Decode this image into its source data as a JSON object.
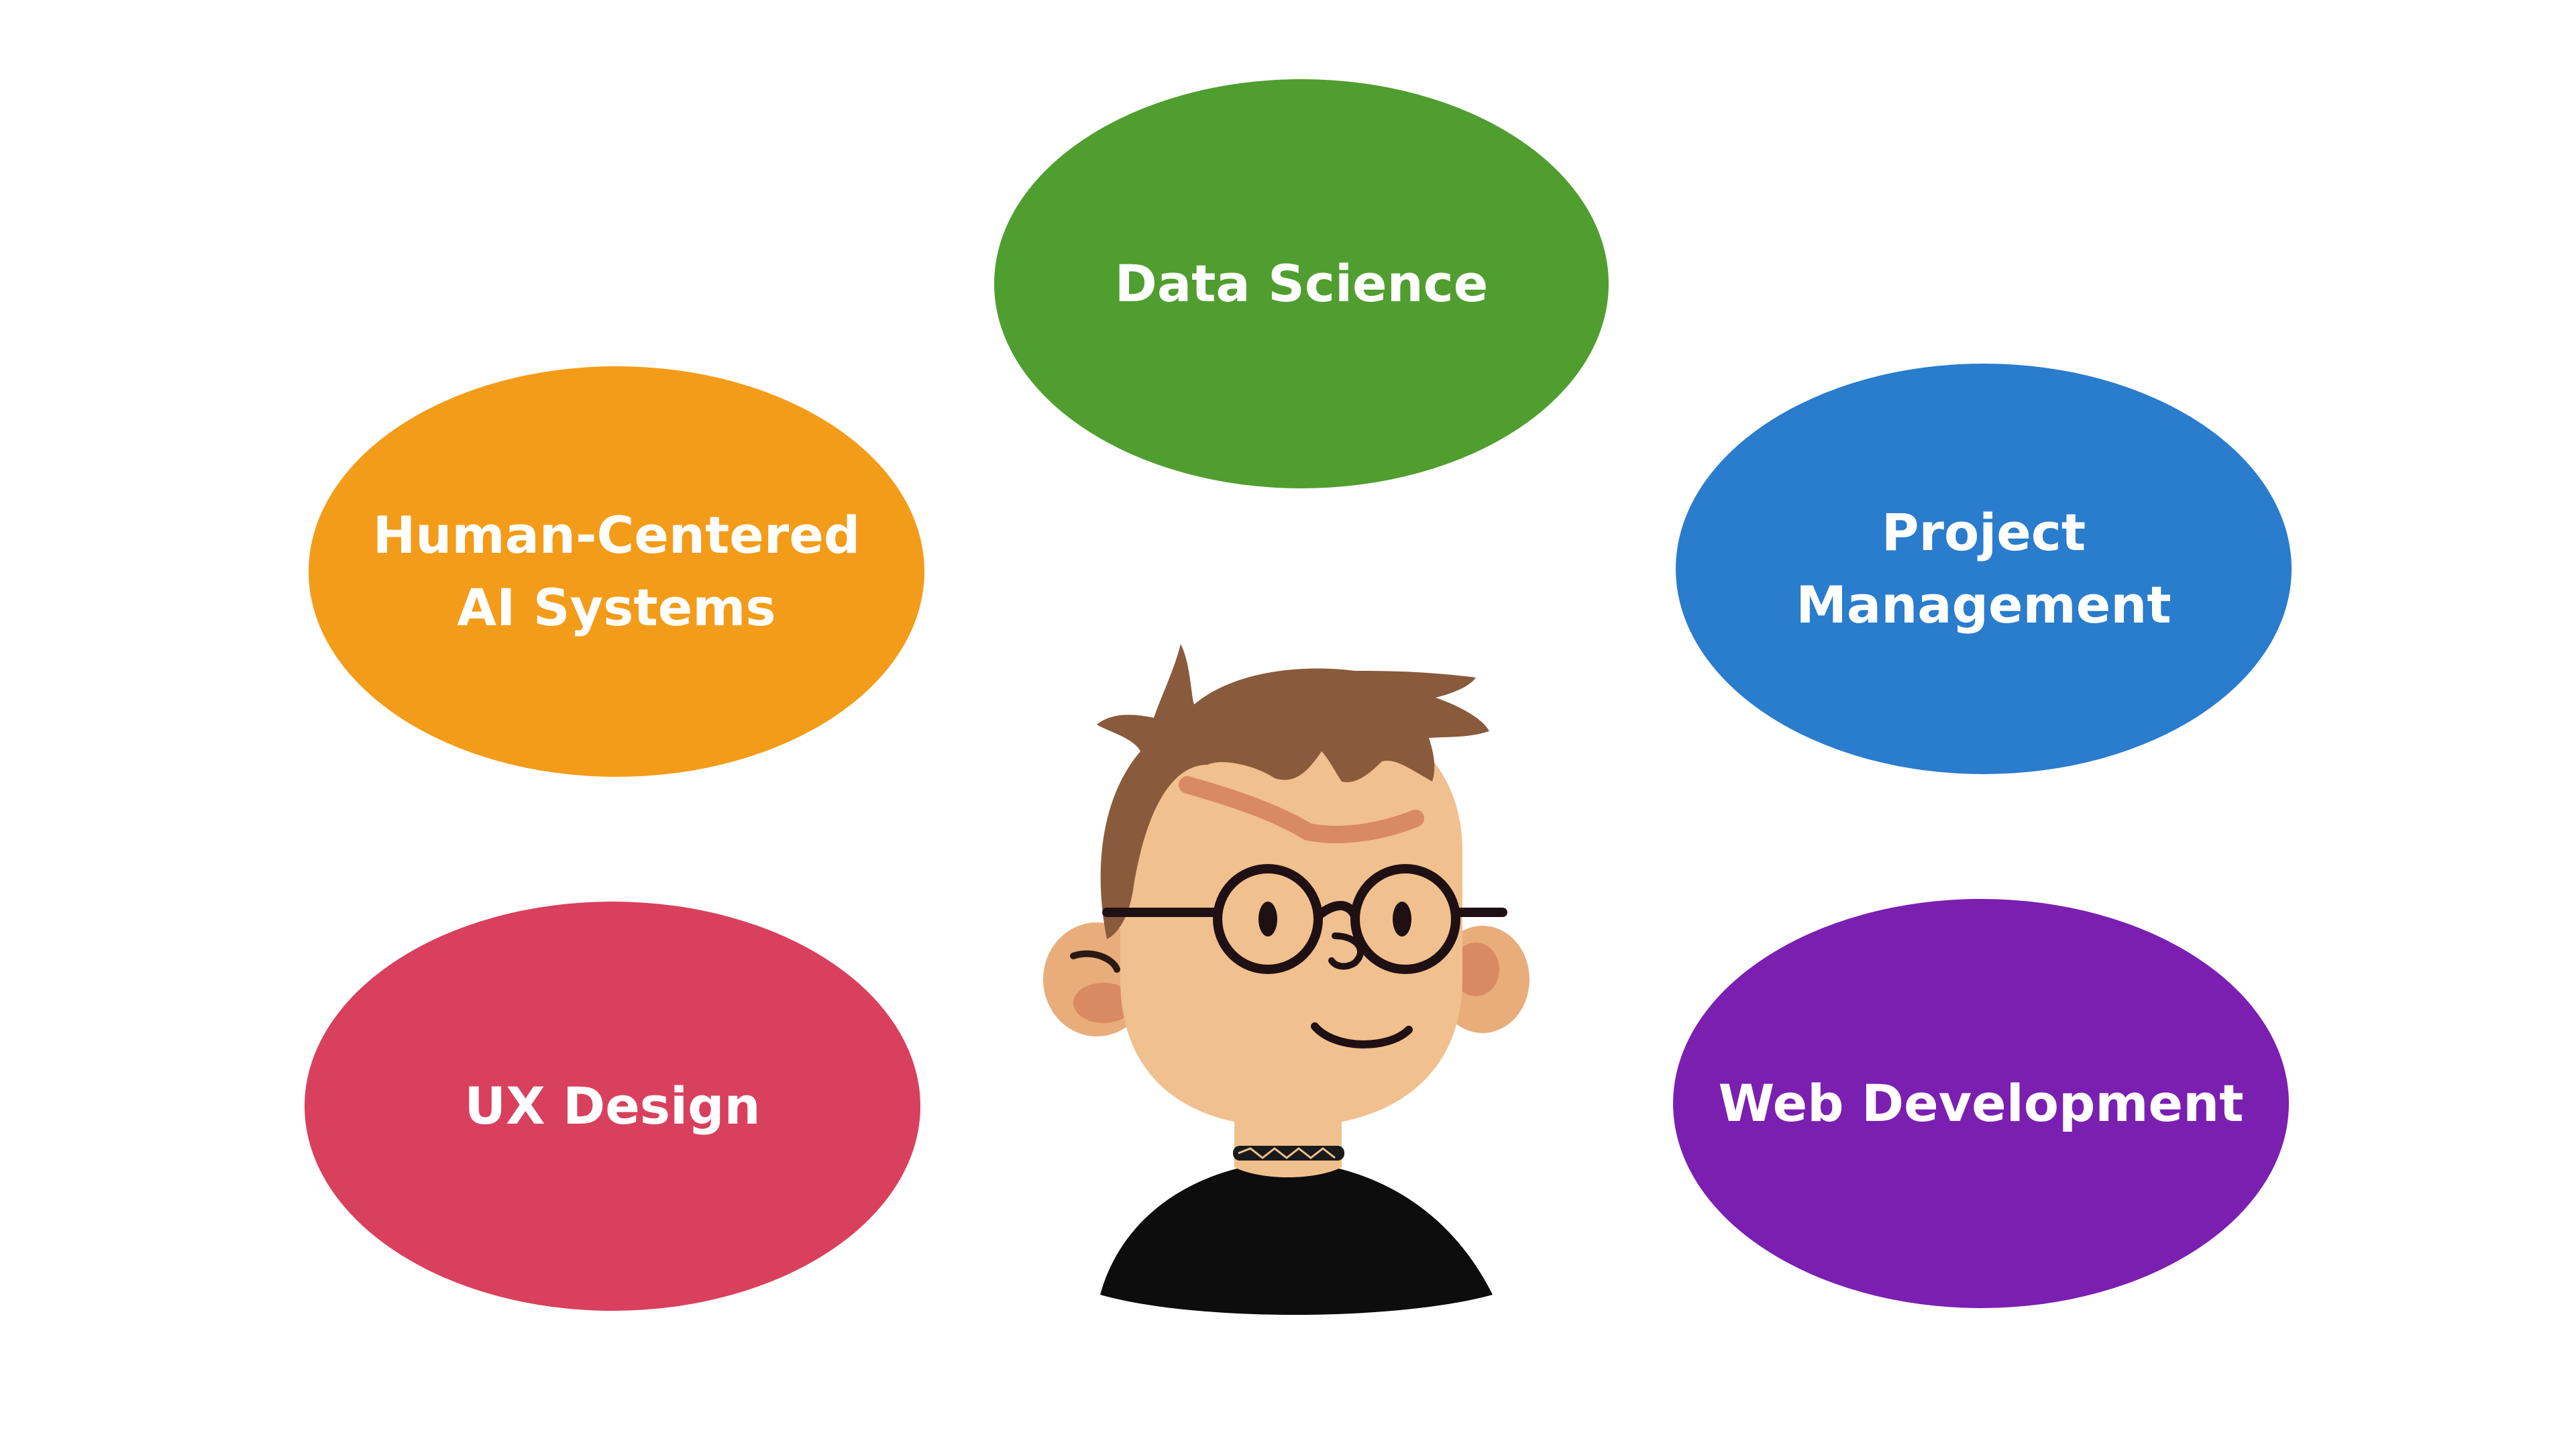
{
  "diagram": {
    "topics": [
      {
        "label": "Data Science",
        "color": "#509e2f"
      },
      {
        "label": "Human-Centered\nAI Systems",
        "color": "#f39c19"
      },
      {
        "label": "Project\nManagement",
        "color": "#2a7ccc"
      },
      {
        "label": "UX Design",
        "color": "#d9405d"
      },
      {
        "label": "Web Development",
        "color": "#7b1fb1"
      }
    ],
    "avatar": {
      "icon": "person-with-glasses-illustration",
      "hair_color": "#8a5a3c",
      "skin_color": "#f0c08e",
      "shirt_color": "#0d0d0d"
    }
  }
}
